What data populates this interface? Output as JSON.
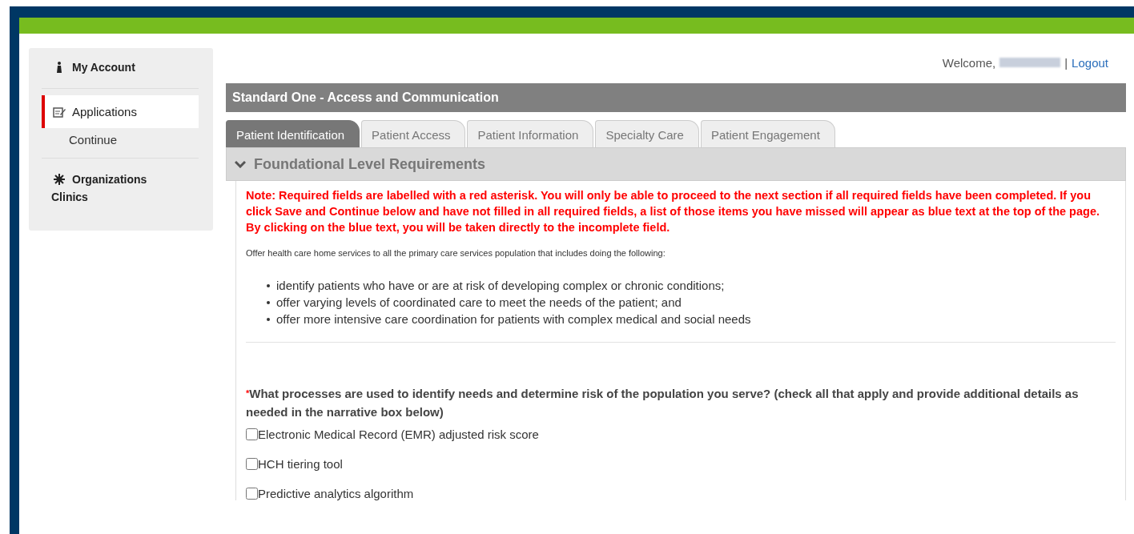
{
  "sidebar": {
    "items": [
      {
        "label": "My Account",
        "kind": "person",
        "selected": false
      },
      {
        "label": "Applications",
        "kind": "edit",
        "selected": true,
        "children": [
          {
            "label": "Continue"
          }
        ]
      },
      {
        "label": "Organizations",
        "kind": "gear",
        "selected": false,
        "subtitle": "Clinics"
      }
    ]
  },
  "header": {
    "welcome": "Welcome,",
    "separator": "|",
    "logout": "Logout"
  },
  "standard_title": "Standard One - Access and Communication",
  "tabs": [
    {
      "label": "Patient Identification",
      "selected": true
    },
    {
      "label": "Patient Access",
      "selected": false
    },
    {
      "label": "Patient Information",
      "selected": false
    },
    {
      "label": "Specialty Care",
      "selected": false
    },
    {
      "label": "Patient Engagement",
      "selected": false
    }
  ],
  "section": {
    "title": "Foundational Level Requirements",
    "expanded": true,
    "note": "Note: Required fields are labelled with a red asterisk. You will only be able to proceed to the next section if all required fields have been completed. If you click Save and Continue below and have not filled in all required fields, a list of those items you have missed will appear as blue text at the top of the page. By clicking on the blue  text, you will be taken directly to the incomplete field.",
    "intro": "Offer health care home services to all the primary care services population that includes doing the following:",
    "bullets": [
      "identify patients who have or are at risk of developing complex or chronic conditions;",
      "offer varying levels of coordinated care to meet the needs of the patient; and",
      "offer more intensive care coordination for patients with complex medical and social needs"
    ],
    "question": {
      "required_mark": "*",
      "text": "What processes are used to identify needs and determine risk of the population you serve? (check all that apply and provide additional details as needed in the narrative box below)",
      "options": [
        {
          "label": "Electronic Medical Record (EMR) adjusted risk score",
          "checked": false
        },
        {
          "label": "HCH tiering tool",
          "checked": false
        },
        {
          "label": "Predictive analytics algorithm",
          "checked": false
        }
      ]
    }
  }
}
